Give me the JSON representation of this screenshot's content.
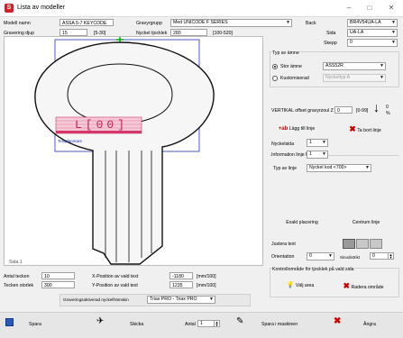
{
  "window": {
    "title": "Lista av modeller",
    "app_icon_glyph": "S",
    "controls": {
      "minimize": "–",
      "maximize": "□",
      "close": "✕"
    }
  },
  "top": {
    "model_label": "Modell namn",
    "model_value": "ASSA 5-7 KEYCODE",
    "depth_label": "Gravering djup",
    "depth_value": "15",
    "depth_range": "[5-30]",
    "group_label": "Gravyrgrupp",
    "group_value": "Med UNICODE F SERIES",
    "key_label": "Nyckel tjocklek",
    "key_value": "280",
    "key_range": "[100-520]"
  },
  "right_top": {
    "back_label": "Back",
    "back_value": "BR4V54UA-LA",
    "side_label": "Sida",
    "side_value": "UA-LA",
    "step_label": "Skepp",
    "step_value": "0"
  },
  "type_group": {
    "title": "Typ av ämne",
    "radio_standard": "Stor ämne",
    "radio_custom": "Kustomiserad",
    "standard_value": "ASS52R",
    "custom_value": "Nyckeltyp A"
  },
  "vertical": {
    "label": "VERTIKAL offset gravyrzoul Z",
    "value": "0",
    "range": "[0-99]",
    "arrow_glyph": "↓",
    "arrow_value": "0",
    "arrow_unit": "%"
  },
  "line_buttons": {
    "add_label": "Lägg till linje",
    "remove_label": "Ta bort linje"
  },
  "info": {
    "key_side_label": "Nyckelsida",
    "key_side_value": "1",
    "info_line_label": "Information linje Nr",
    "info_line_value": "1",
    "type_line_label": "Typ av linje",
    "type_line_value": "Nyckel kod <700>"
  },
  "placement": {
    "exact_label": "Exakt placering",
    "center_label": "Centrum linje"
  },
  "justify": {
    "label": "Justera text",
    "orientation_label": "Orientation",
    "orientation_value": "0",
    "spacing_label": "Sinodistrikt",
    "spacing_value": "0"
  },
  "control_area": {
    "title": "Kontrollområde för tjocklek på vald sida",
    "choose_label": "Välj area",
    "delete_label": "Radera område"
  },
  "canvas": {
    "key_code": "L[00]",
    "small_label": "Textplacerare",
    "page_label": "Sida 1"
  },
  "bottom": {
    "chars_label": "Antal tecken",
    "chars_value": "10",
    "size_label": "Tecken storlek",
    "size_value": "300",
    "xpos_label": "X-Position av vald text",
    "xpos_value": "-1180",
    "ypos_label": "Y-Position av vald text",
    "ypos_value": "1235",
    "unit": "[mm/100]",
    "machine_label": "Graveringsaktiverad nyckelfrämskin",
    "machine_value": "Triax PRO",
    "machine_value2": "Triax PRO"
  },
  "toolbar": {
    "save": "Spara",
    "send": "Skicka",
    "count_label": "Antal",
    "count_value": "1",
    "save_machine": "Spara i maskinen",
    "undo": "Ångra"
  }
}
